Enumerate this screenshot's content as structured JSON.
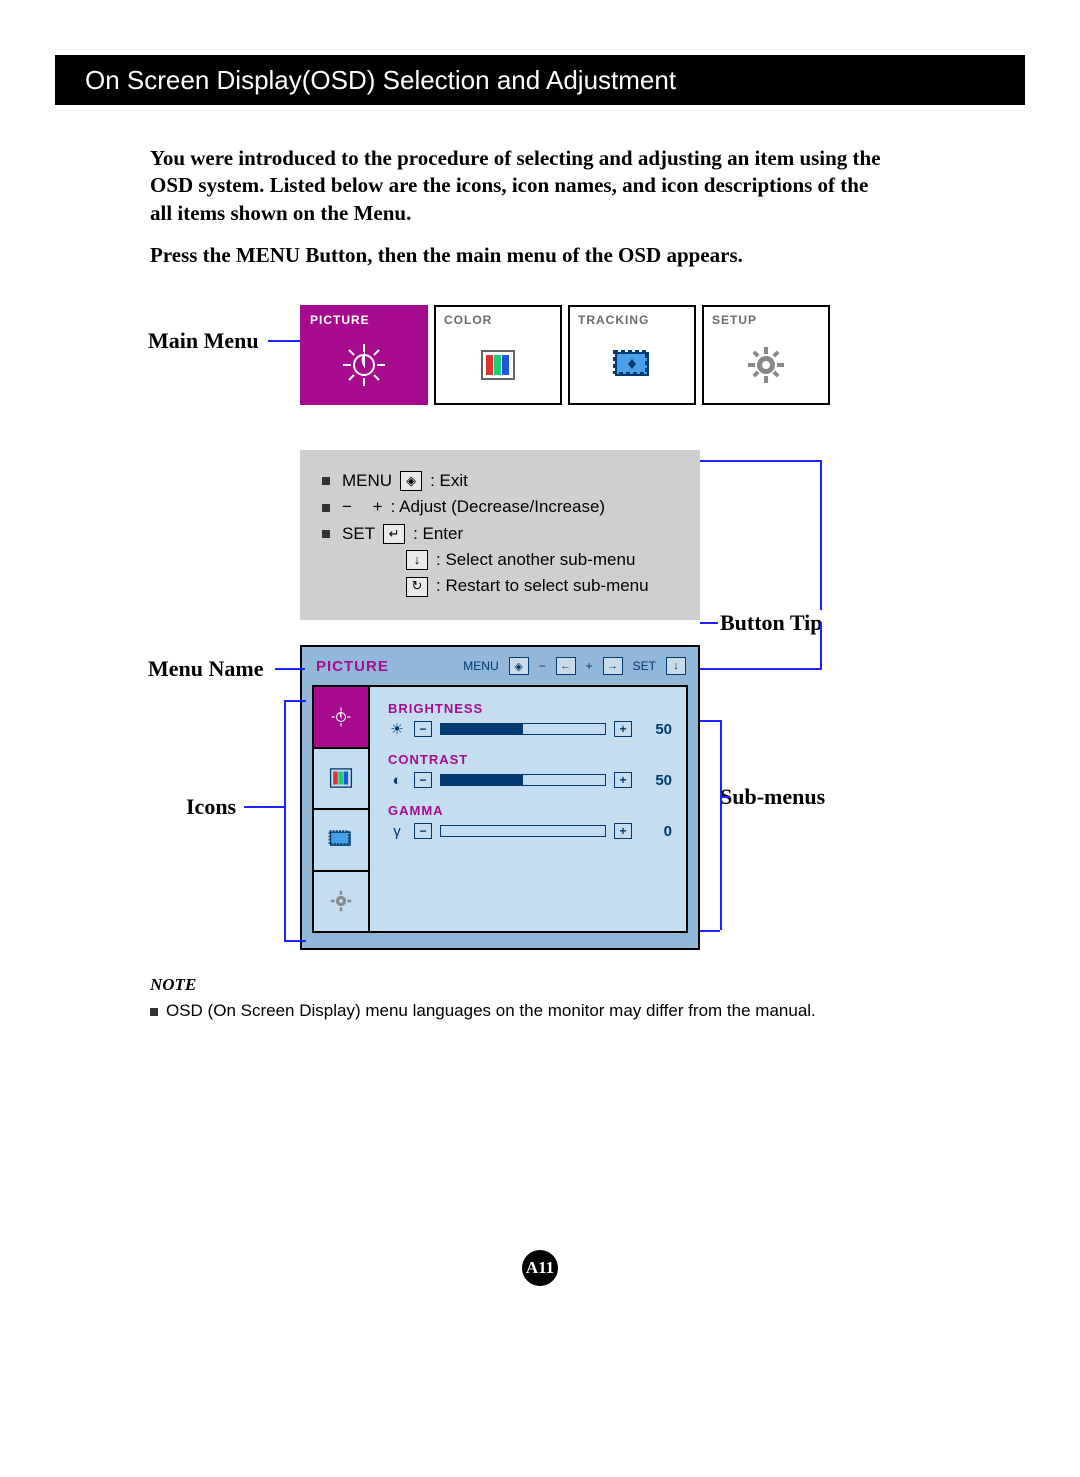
{
  "header": {
    "title": "On Screen Display(OSD) Selection and Adjustment"
  },
  "intro": "You were introduced to the procedure of selecting and adjusting an item using the OSD system.  Listed below are the icons, icon names, and icon descriptions of the all items shown on the Menu.",
  "press_line": "Press the MENU Button, then the main menu of the OSD appears.",
  "labels": {
    "main_menu": "Main Menu",
    "menu_name": "Menu Name",
    "icons": "Icons",
    "button_tip": "Button Tip",
    "sub_menus": "Sub-menus"
  },
  "tabs": [
    {
      "label": "PICTURE",
      "active": true,
      "icon": "brightness-contrast-icon"
    },
    {
      "label": "COLOR",
      "active": false,
      "icon": "color-bars-icon"
    },
    {
      "label": "TRACKING",
      "active": false,
      "icon": "tracking-icon"
    },
    {
      "label": "SETUP",
      "active": false,
      "icon": "gear-icon"
    }
  ],
  "tips": {
    "menu_word": "MENU",
    "menu_after": ": Exit",
    "minus": "−",
    "plus": "+",
    "adjust_text": ": Adjust (Decrease/Increase)",
    "set_word": "SET",
    "set_after": ": Enter",
    "down_after": ": Select another sub-menu",
    "restart_after": ": Restart to select sub-menu"
  },
  "osd": {
    "title": "PICTURE",
    "header_menu": "MENU",
    "header_set": "SET",
    "minus": "−",
    "plus": "+",
    "side_icons": [
      "brightness-contrast-icon",
      "color-bars-icon",
      "tracking-icon",
      "gear-icon"
    ],
    "settings": [
      {
        "name": "BRIGHTNESS",
        "icon": "sun-icon",
        "value": "50",
        "fill_pct": 50
      },
      {
        "name": "CONTRAST",
        "icon": "contrast-icon",
        "value": "50",
        "fill_pct": 50
      },
      {
        "name": "GAMMA",
        "icon": "gamma-icon",
        "value": "0",
        "fill_pct": 0
      }
    ]
  },
  "note": {
    "title": "NOTE",
    "text": "OSD (On Screen Display) menu languages on the monitor may differ from the manual."
  },
  "page": "A11"
}
